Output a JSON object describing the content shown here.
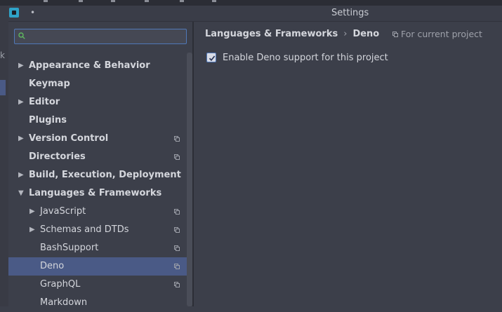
{
  "window": {
    "title": "Settings",
    "title_dot": "•"
  },
  "search": {
    "value": "",
    "placeholder": ""
  },
  "sidebar": {
    "items": [
      {
        "label": "Appearance & Behavior",
        "bold": true,
        "arrow": "▶"
      },
      {
        "label": "Keymap",
        "bold": true
      },
      {
        "label": "Editor",
        "bold": true,
        "arrow": "▶"
      },
      {
        "label": "Plugins",
        "bold": true
      },
      {
        "label": "Version Control",
        "bold": true,
        "arrow": "▶",
        "project_scoped": true
      },
      {
        "label": "Directories",
        "bold": true,
        "project_scoped": true
      },
      {
        "label": "Build, Execution, Deployment",
        "bold": true,
        "arrow": "▶"
      },
      {
        "label": "Languages & Frameworks",
        "bold": true,
        "arrow": "▼",
        "expanded": true
      },
      {
        "label": "JavaScript",
        "arrow": "▶",
        "project_scoped": true
      },
      {
        "label": "Schemas and DTDs",
        "arrow": "▶",
        "project_scoped": true
      },
      {
        "label": "BashSupport",
        "project_scoped": true
      },
      {
        "label": "Deno",
        "project_scoped": true,
        "selected": true
      },
      {
        "label": "GraphQL",
        "project_scoped": true
      },
      {
        "label": "Markdown"
      }
    ]
  },
  "content": {
    "breadcrumb": {
      "parent": "Languages & Frameworks",
      "separator": "›",
      "current": "Deno"
    },
    "scope": "For current project",
    "option": {
      "label": "Enable Deno support for this project",
      "checked": true
    }
  },
  "background": {
    "left_char": "k"
  },
  "colors": {
    "accent": "#4a5a86",
    "focus_border": "#5078b8",
    "search_icon": "#5fb85f"
  }
}
